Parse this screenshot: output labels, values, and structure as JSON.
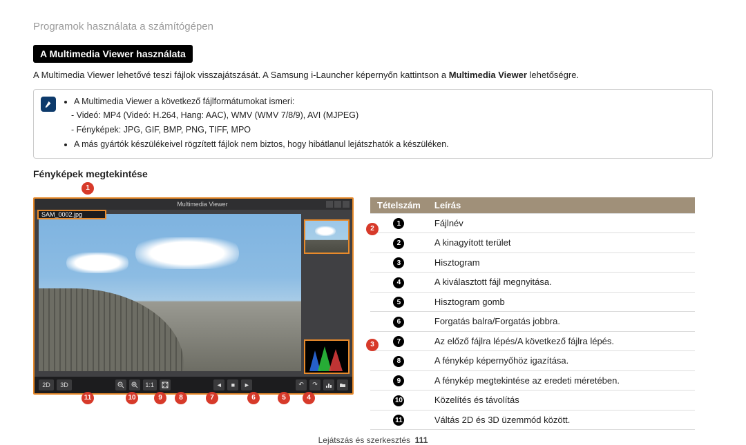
{
  "breadcrumb": "Programok használata a számítógépen",
  "section_header": "A Multimedia Viewer használata",
  "intro_pre": "A Multimedia Viewer lehetővé teszi fájlok visszajátszását. A Samsung i-Launcher képernyőn kattintson a ",
  "intro_bold": "Multimedia Viewer",
  "intro_post": " lehetőségre.",
  "info": {
    "line1": "A Multimedia Viewer a következő fájlformátumokat ismeri:",
    "line2": "Videó: MP4 (Videó: H.264, Hang: AAC), WMV (WMV 7/8/9), AVI (MJPEG)",
    "line3": "Fényképek: JPG, GIF, BMP, PNG, TIFF, MPO",
    "line4": "A más gyártók készülékeivel rögzített fájlok nem biztos, hogy hibátlanul lejátszhatók a készüléken."
  },
  "subheading": "Fényképek megtekintése",
  "viewer": {
    "title": "Multimedia Viewer",
    "filename": "SAM_0002.jpg",
    "btn_2d": "2D",
    "btn_3d": "3D",
    "btn_1to1": "1:1"
  },
  "markers": {
    "m1": "1",
    "m2": "2",
    "m3": "3",
    "m4": "4",
    "m5": "5",
    "m6": "6",
    "m7": "7",
    "m8": "8",
    "m9": "9",
    "m10": "10",
    "m11": "11"
  },
  "table": {
    "col_num": "Tételszám",
    "col_desc": "Leírás",
    "rows": [
      {
        "n": "1",
        "d": "Fájlnév"
      },
      {
        "n": "2",
        "d": "A kinagyított terület"
      },
      {
        "n": "3",
        "d": "Hisztogram"
      },
      {
        "n": "4",
        "d": "A kiválasztott fájl megnyitása."
      },
      {
        "n": "5",
        "d": "Hisztogram gomb"
      },
      {
        "n": "6",
        "d": "Forgatás balra/Forgatás jobbra."
      },
      {
        "n": "7",
        "d": "Az előző fájlra lépés/A következő fájlra lépés."
      },
      {
        "n": "8",
        "d": "A fénykép képernyőhöz igazítása."
      },
      {
        "n": "9",
        "d": "A fénykép megtekintése az eredeti méretében."
      },
      {
        "n": "10",
        "d": "Közelítés és távolítás"
      },
      {
        "n": "11",
        "d": "Váltás 2D és 3D üzemmód között."
      }
    ]
  },
  "footer_text": "Lejátszás és szerkesztés",
  "footer_page": "111"
}
